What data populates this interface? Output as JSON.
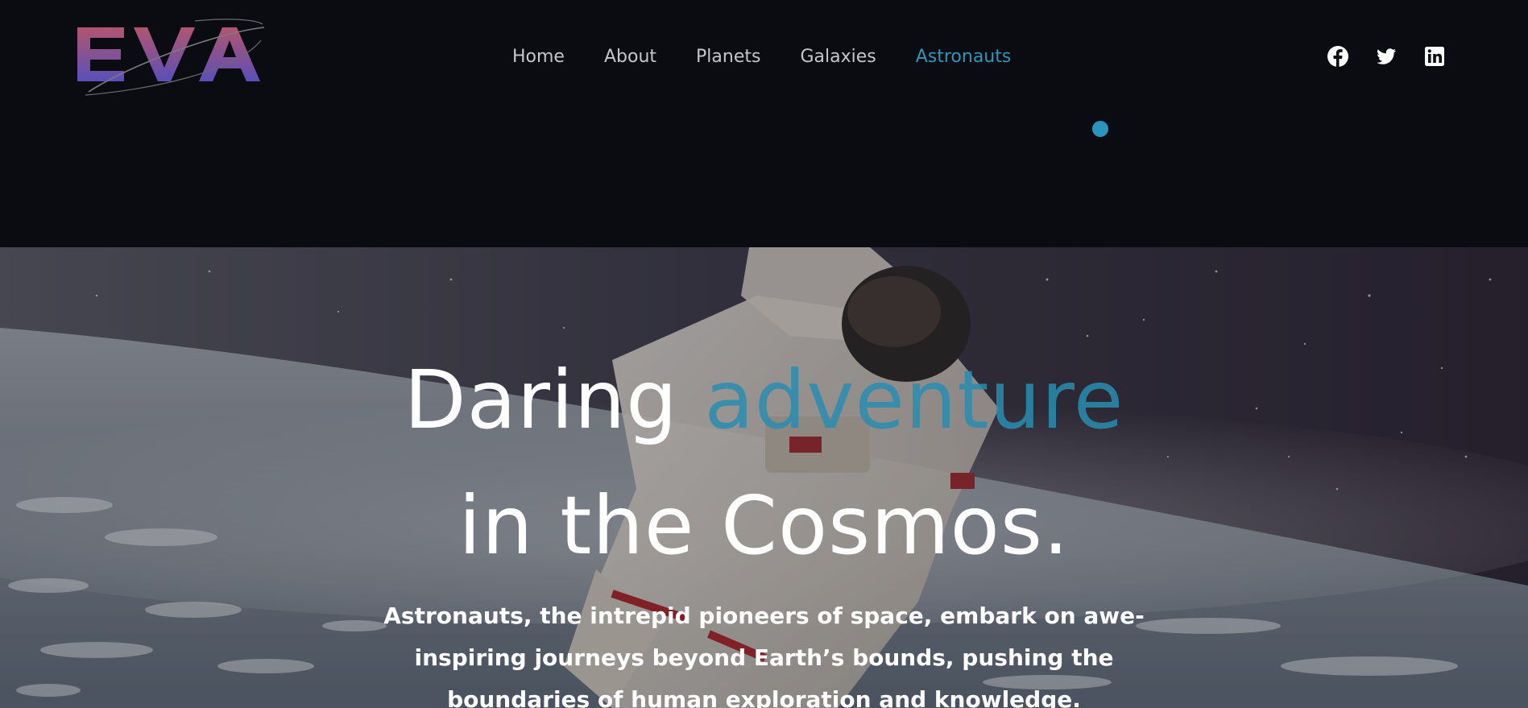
{
  "logo": {
    "text": "EVA"
  },
  "nav": {
    "items": [
      {
        "label": "Home",
        "active": false
      },
      {
        "label": "About",
        "active": false
      },
      {
        "label": "Planets",
        "active": false
      },
      {
        "label": "Galaxies",
        "active": false
      },
      {
        "label": "Astronauts",
        "active": true
      }
    ]
  },
  "social": {
    "icons": [
      "facebook-icon",
      "twitter-icon",
      "linkedin-icon"
    ]
  },
  "hero": {
    "title_word1": "Daring",
    "title_accent": "adventure",
    "title_line2": "in the Cosmos.",
    "description": "Astronauts, the intrepid pioneers of space, embark on awe-inspiring journeys beyond Earth’s bounds, pushing the boundaries of human exploration and knowledge."
  },
  "colors": {
    "background": "#0b0c11",
    "accent": "#2a94bb",
    "nav_text": "#c5c6cb",
    "logo_gradient_start": "#b2556f",
    "logo_gradient_end": "#5a4fb8"
  }
}
